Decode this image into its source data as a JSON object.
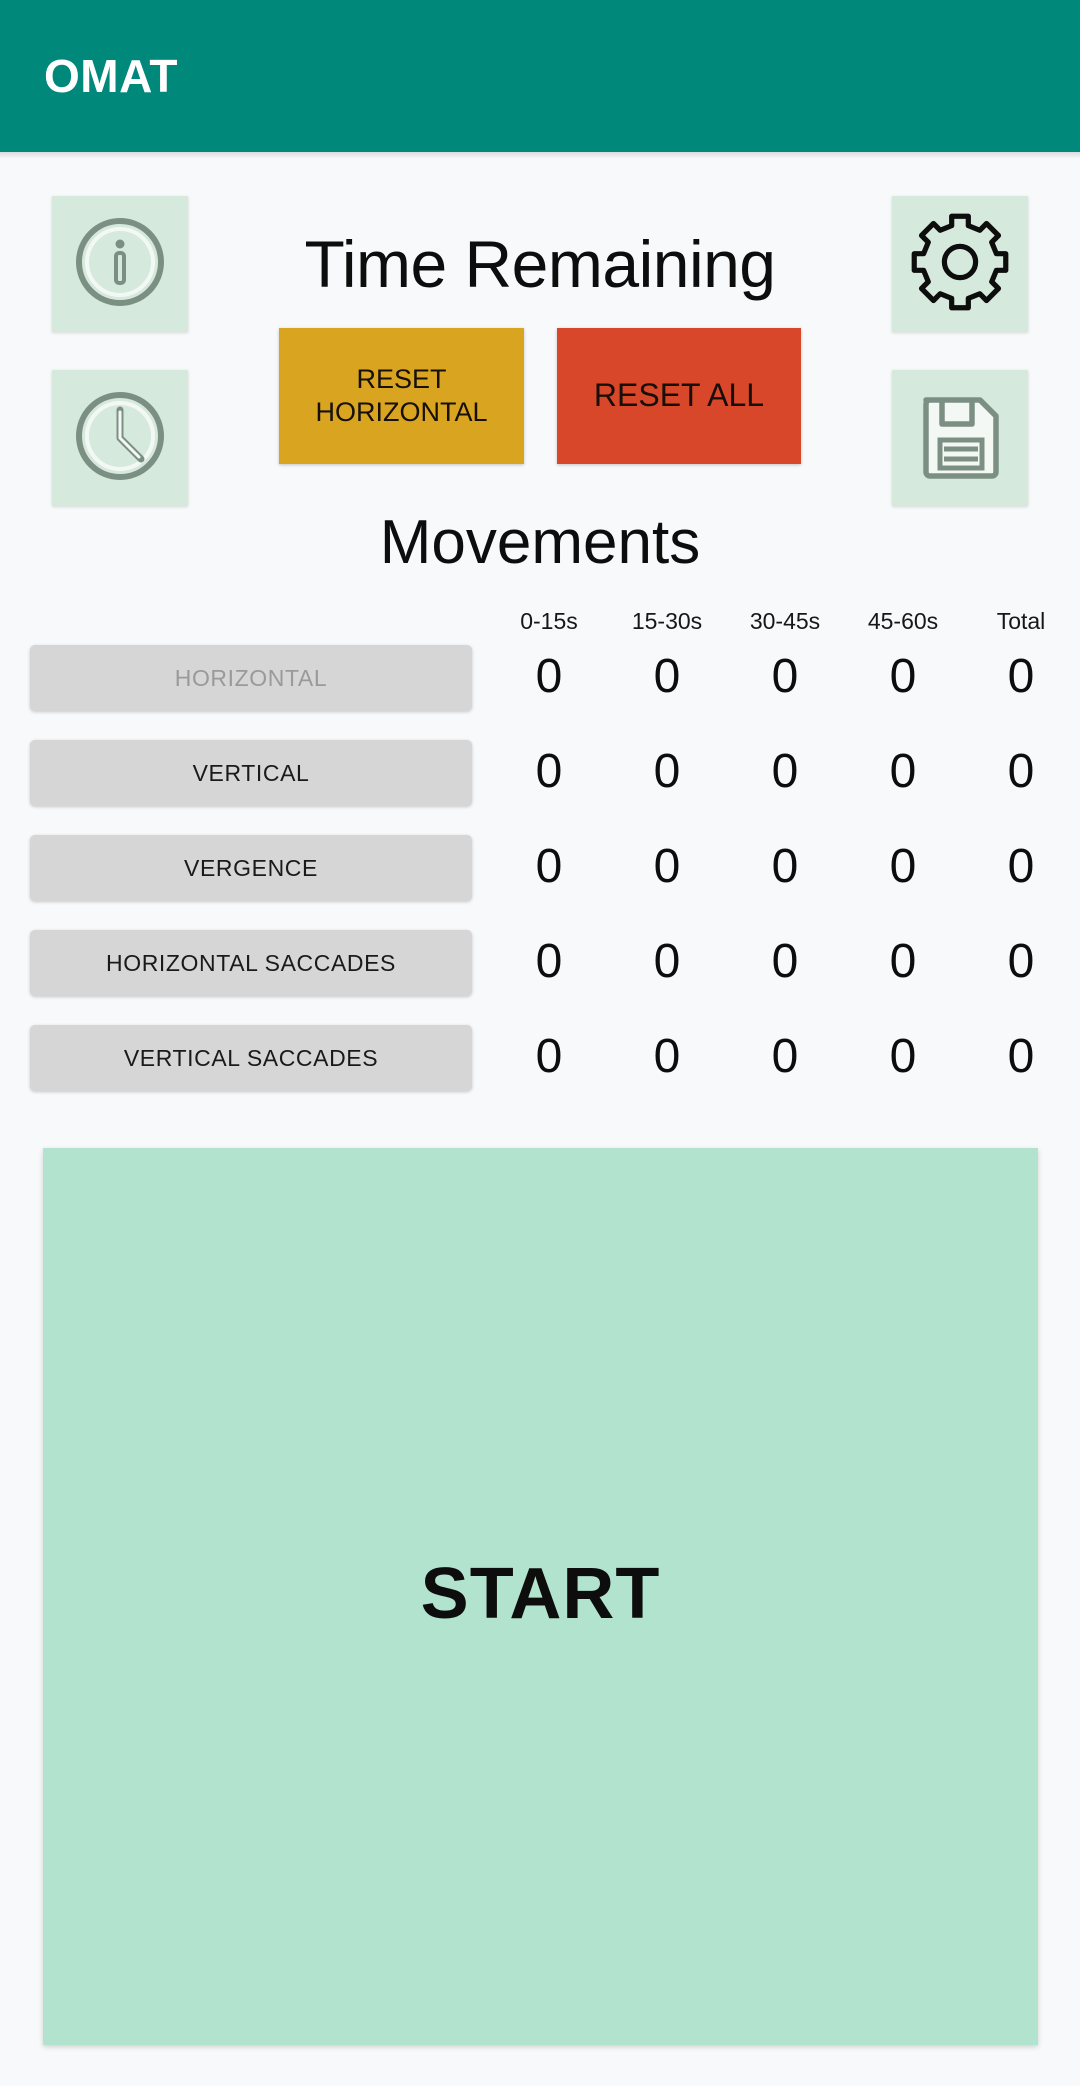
{
  "appbar": {
    "title": "OMAT",
    "bg_color": "#00897b",
    "title_color": "#ffffff"
  },
  "header": {
    "time_remaining_label": "Time Remaining",
    "movements_label": "Movements",
    "icons": {
      "info": "info-circle-icon",
      "clock": "clock-icon",
      "gear": "gear-icon",
      "save": "floppy-disk-save-icon"
    },
    "tile_color": "#d5e9dc"
  },
  "buttons": {
    "reset_horizontal": "RESET\nHORIZONTAL",
    "reset_horizontal_line1": "RESET",
    "reset_horizontal_line2": "HORIZONTAL",
    "reset_horizontal_color": "#d9a420",
    "reset_all": "RESET ALL",
    "reset_all_color": "#d9472b"
  },
  "table": {
    "columns": [
      "0-15s",
      "15-30s",
      "30-45s",
      "45-60s",
      "Total"
    ],
    "rows": [
      {
        "label": "HORIZONTAL",
        "disabled": true,
        "values": [
          "0",
          "0",
          "0",
          "0",
          "0"
        ]
      },
      {
        "label": "VERTICAL",
        "disabled": false,
        "values": [
          "0",
          "0",
          "0",
          "0",
          "0"
        ]
      },
      {
        "label": "VERGENCE",
        "disabled": false,
        "values": [
          "0",
          "0",
          "0",
          "0",
          "0"
        ]
      },
      {
        "label": "HORIZONTAL SACCADES",
        "disabled": false,
        "values": [
          "0",
          "0",
          "0",
          "0",
          "0"
        ]
      },
      {
        "label": "VERTICAL SACCADES",
        "disabled": false,
        "values": [
          "0",
          "0",
          "0",
          "0",
          "0"
        ]
      }
    ],
    "row_button_color": "#d6d6d6"
  },
  "start": {
    "label": "START",
    "bg_color": "#b2e3ce"
  }
}
